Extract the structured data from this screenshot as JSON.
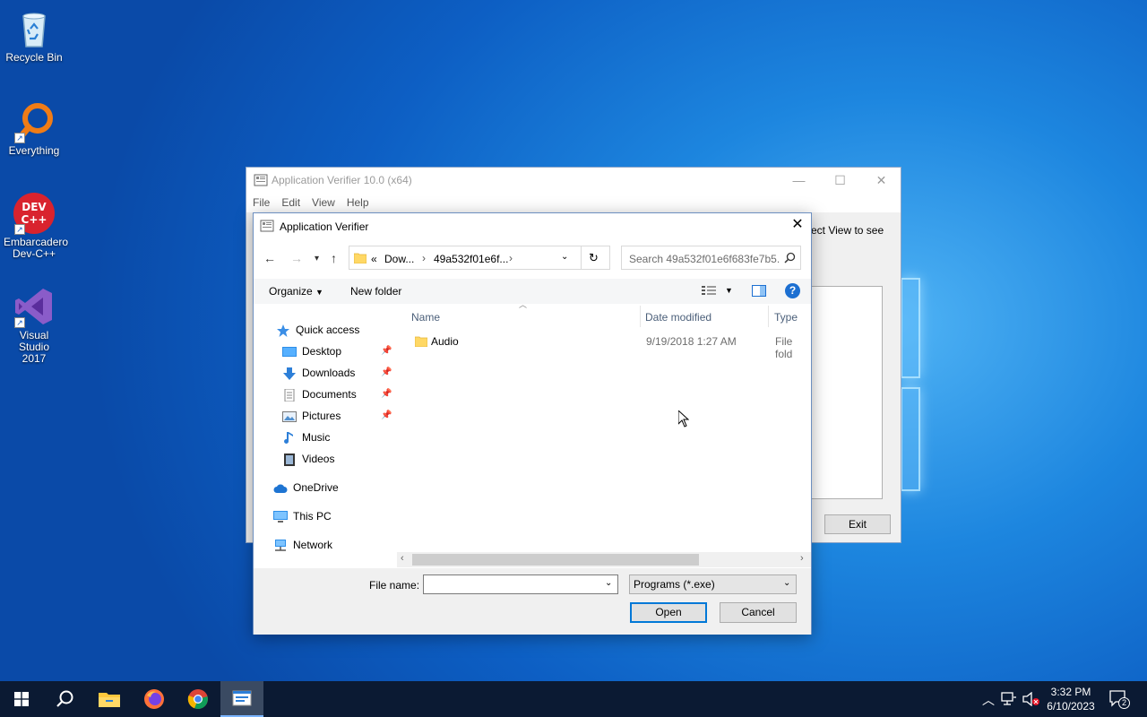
{
  "desktop": {
    "icons": [
      {
        "label": "Recycle Bin"
      },
      {
        "label": "Everything"
      },
      {
        "label": "Embarcadero Dev-C++"
      },
      {
        "label": "Visual Studio 2017"
      }
    ]
  },
  "back_window": {
    "title": "Application Verifier 10.0 (x64)",
    "menu": [
      "File",
      "Edit",
      "View",
      "Help"
    ],
    "hint_text": "ect View to see",
    "exit_label": "Exit"
  },
  "dialog": {
    "title": "Application Verifier",
    "address": {
      "overflow": "«",
      "seg1": "Dow...",
      "seg2": "49a532f01e6f...",
      "sep": "›"
    },
    "search_placeholder": "Search 49a532f01e6f683fe7b5...",
    "toolbar": {
      "organize": "Organize",
      "new_folder": "New folder",
      "help": "?"
    },
    "nav": {
      "quick_access": "Quick access",
      "desktop": "Desktop",
      "downloads": "Downloads",
      "documents": "Documents",
      "pictures": "Pictures",
      "music": "Music",
      "videos": "Videos",
      "onedrive": "OneDrive",
      "this_pc": "This PC",
      "network": "Network"
    },
    "columns": {
      "name": "Name",
      "date": "Date modified",
      "type": "Type"
    },
    "files": [
      {
        "name": "Audio",
        "date": "9/19/2018 1:27 AM",
        "type": "File fold"
      }
    ],
    "file_name_label": "File name:",
    "file_name_value": "",
    "file_type": "Programs (*.exe)",
    "open_label": "Open",
    "cancel_label": "Cancel"
  },
  "taskbar": {
    "time": "3:32 PM",
    "date": "6/10/2023",
    "notification_count": "2"
  },
  "colors": {
    "accent": "#0078d7",
    "taskbar": "#0b1a33",
    "help_blue": "#1c6fd1"
  }
}
